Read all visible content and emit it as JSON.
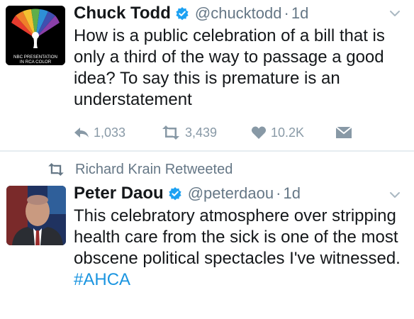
{
  "tweets": [
    {
      "name": "Chuck Todd",
      "handle": "@chucktodd",
      "separator": "·",
      "time": "1d",
      "text": "How is a public celebration of a bill that is only a third of the way to passage a good idea? To say this is premature is an understatement",
      "avatar_text_line1": "NBC PRESENTATION",
      "avatar_text_line2": "IN RCA COLOR",
      "actions": {
        "reply_count": "1,033",
        "retweet_count": "3,439",
        "like_count": "10.2K"
      }
    },
    {
      "retweeted_by": "Richard Krain Retweeted",
      "name": "Peter Daou",
      "handle": "@peterdaou",
      "separator": "·",
      "time": "1d",
      "text": "This celebratory atmosphere over stripping health care from the sick is one of the most obscene political spectacles I've witnessed.",
      "hashtag": "#AHCA"
    }
  ],
  "colors": {
    "verified": "#1da1f2",
    "hashtag": "#1b95e0",
    "muted": "#657786",
    "action": "#8899a6"
  }
}
